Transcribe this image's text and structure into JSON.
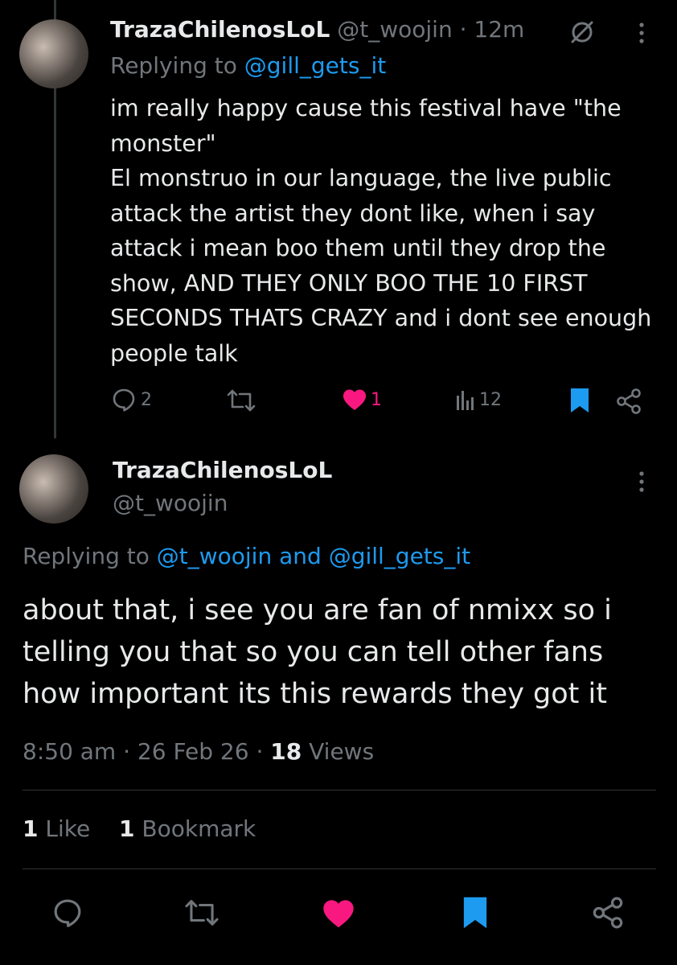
{
  "parent_tweet": {
    "display_name": "TrazaChilenosLoL",
    "handle": "@t_woojin",
    "separator": "·",
    "time": "12m",
    "replying_prefix": "Replying to",
    "replying_to": "@gill_gets_it",
    "text": "im really happy cause this festival have \"the monster\"\nEl monstruo in our language, the live public attack the artist they dont like, when i say attack i mean boo them until they drop the show, AND THEY ONLY BOO THE 10 FIRST SECONDS THATS CRAZY and i dont see enough people talk",
    "actions": {
      "replies": "2",
      "reposts": "",
      "likes": "1",
      "views": "12"
    },
    "colors": {
      "like": "#f91880",
      "bookmark": "#1d9bf0"
    }
  },
  "main_tweet": {
    "display_name": "TrazaChilenosLoL",
    "handle": "@t_woojin",
    "replying_prefix": "Replying to",
    "replying_to": "@t_woojin and @gill_gets_it",
    "text": "about that, i see you are fan of nmixx so i telling you that so you can tell other fans how important its this rewards they got it",
    "time": "8:50 am",
    "date": "26 Feb 26",
    "views_count": "18",
    "views_label": "Views",
    "likes_count": "1",
    "likes_label": "Like",
    "bookmarks_count": "1",
    "bookmarks_label": "Bookmark"
  },
  "colors": {
    "background": "#000000",
    "text": "#e7e9ea",
    "muted": "#71767b",
    "link": "#1d9bf0",
    "like": "#f91880",
    "divider": "#2f3336"
  }
}
